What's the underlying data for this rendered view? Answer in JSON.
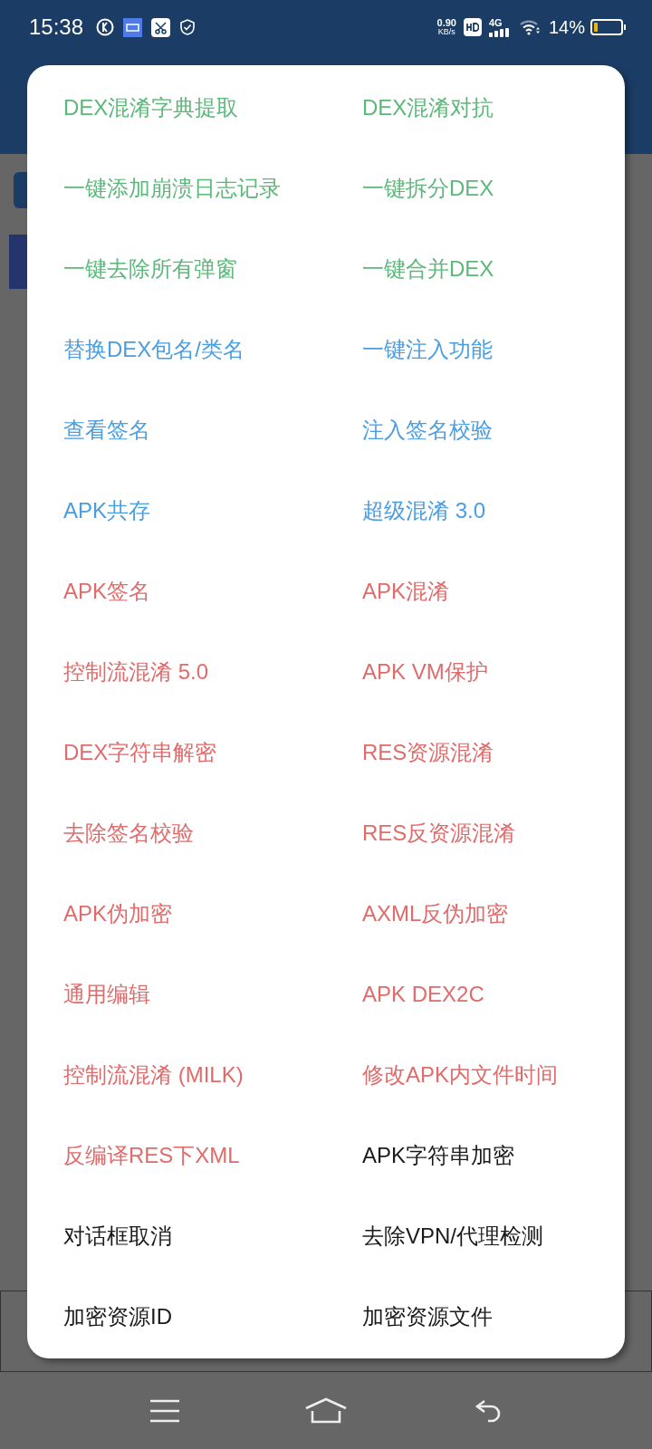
{
  "status_bar": {
    "time": "15:38",
    "net_speed": "0.90",
    "net_unit": "KB/s",
    "network": "4G",
    "battery": "14%"
  },
  "menu": {
    "items": [
      {
        "label": "DEX混淆字典提取",
        "color": "#5cb87a"
      },
      {
        "label": "DEX混淆对抗",
        "color": "#5cb87a"
      },
      {
        "label": "一键添加崩溃日志记录",
        "color": "#5cb87a"
      },
      {
        "label": "一键拆分DEX",
        "color": "#5cb87a"
      },
      {
        "label": "一键去除所有弹窗",
        "color": "#5cb87a"
      },
      {
        "label": "一键合并DEX",
        "color": "#5cb87a"
      },
      {
        "label": "替换DEX包名/类名",
        "color": "#4a9de0"
      },
      {
        "label": "一键注入功能",
        "color": "#4a9de0"
      },
      {
        "label": "查看签名",
        "color": "#4a9de0"
      },
      {
        "label": "注入签名校验",
        "color": "#4a9de0"
      },
      {
        "label": "APK共存",
        "color": "#4a9de0"
      },
      {
        "label": "超级混淆 3.0",
        "color": "#4a9de0"
      },
      {
        "label": "APK签名",
        "color": "#e06b6b"
      },
      {
        "label": "APK混淆",
        "color": "#e06b6b"
      },
      {
        "label": "控制流混淆 5.0",
        "color": "#e06b6b"
      },
      {
        "label": "APK VM保护",
        "color": "#e06b6b"
      },
      {
        "label": "DEX字符串解密",
        "color": "#e06b6b"
      },
      {
        "label": "RES资源混淆",
        "color": "#e06b6b"
      },
      {
        "label": "去除签名校验",
        "color": "#e06b6b"
      },
      {
        "label": "RES反资源混淆",
        "color": "#e06b6b"
      },
      {
        "label": "APK伪加密",
        "color": "#e06b6b"
      },
      {
        "label": "AXML反伪加密",
        "color": "#e06b6b"
      },
      {
        "label": "通用编辑",
        "color": "#e06b6b"
      },
      {
        "label": "APK DEX2C",
        "color": "#e06b6b"
      },
      {
        "label": "控制流混淆 (MILK)",
        "color": "#e06b6b"
      },
      {
        "label": "修改APK内文件时间",
        "color": "#e06b6b"
      },
      {
        "label": "反编译RES下XML",
        "color": "#e06b6b"
      },
      {
        "label": "APK字符串加密",
        "color": "#1a1a1a"
      },
      {
        "label": "对话框取消",
        "color": "#1a1a1a"
      },
      {
        "label": "去除VPN/代理检测",
        "color": "#1a1a1a"
      },
      {
        "label": "加密资源ID",
        "color": "#1a1a1a"
      },
      {
        "label": "加密资源文件",
        "color": "#1a1a1a"
      }
    ]
  }
}
